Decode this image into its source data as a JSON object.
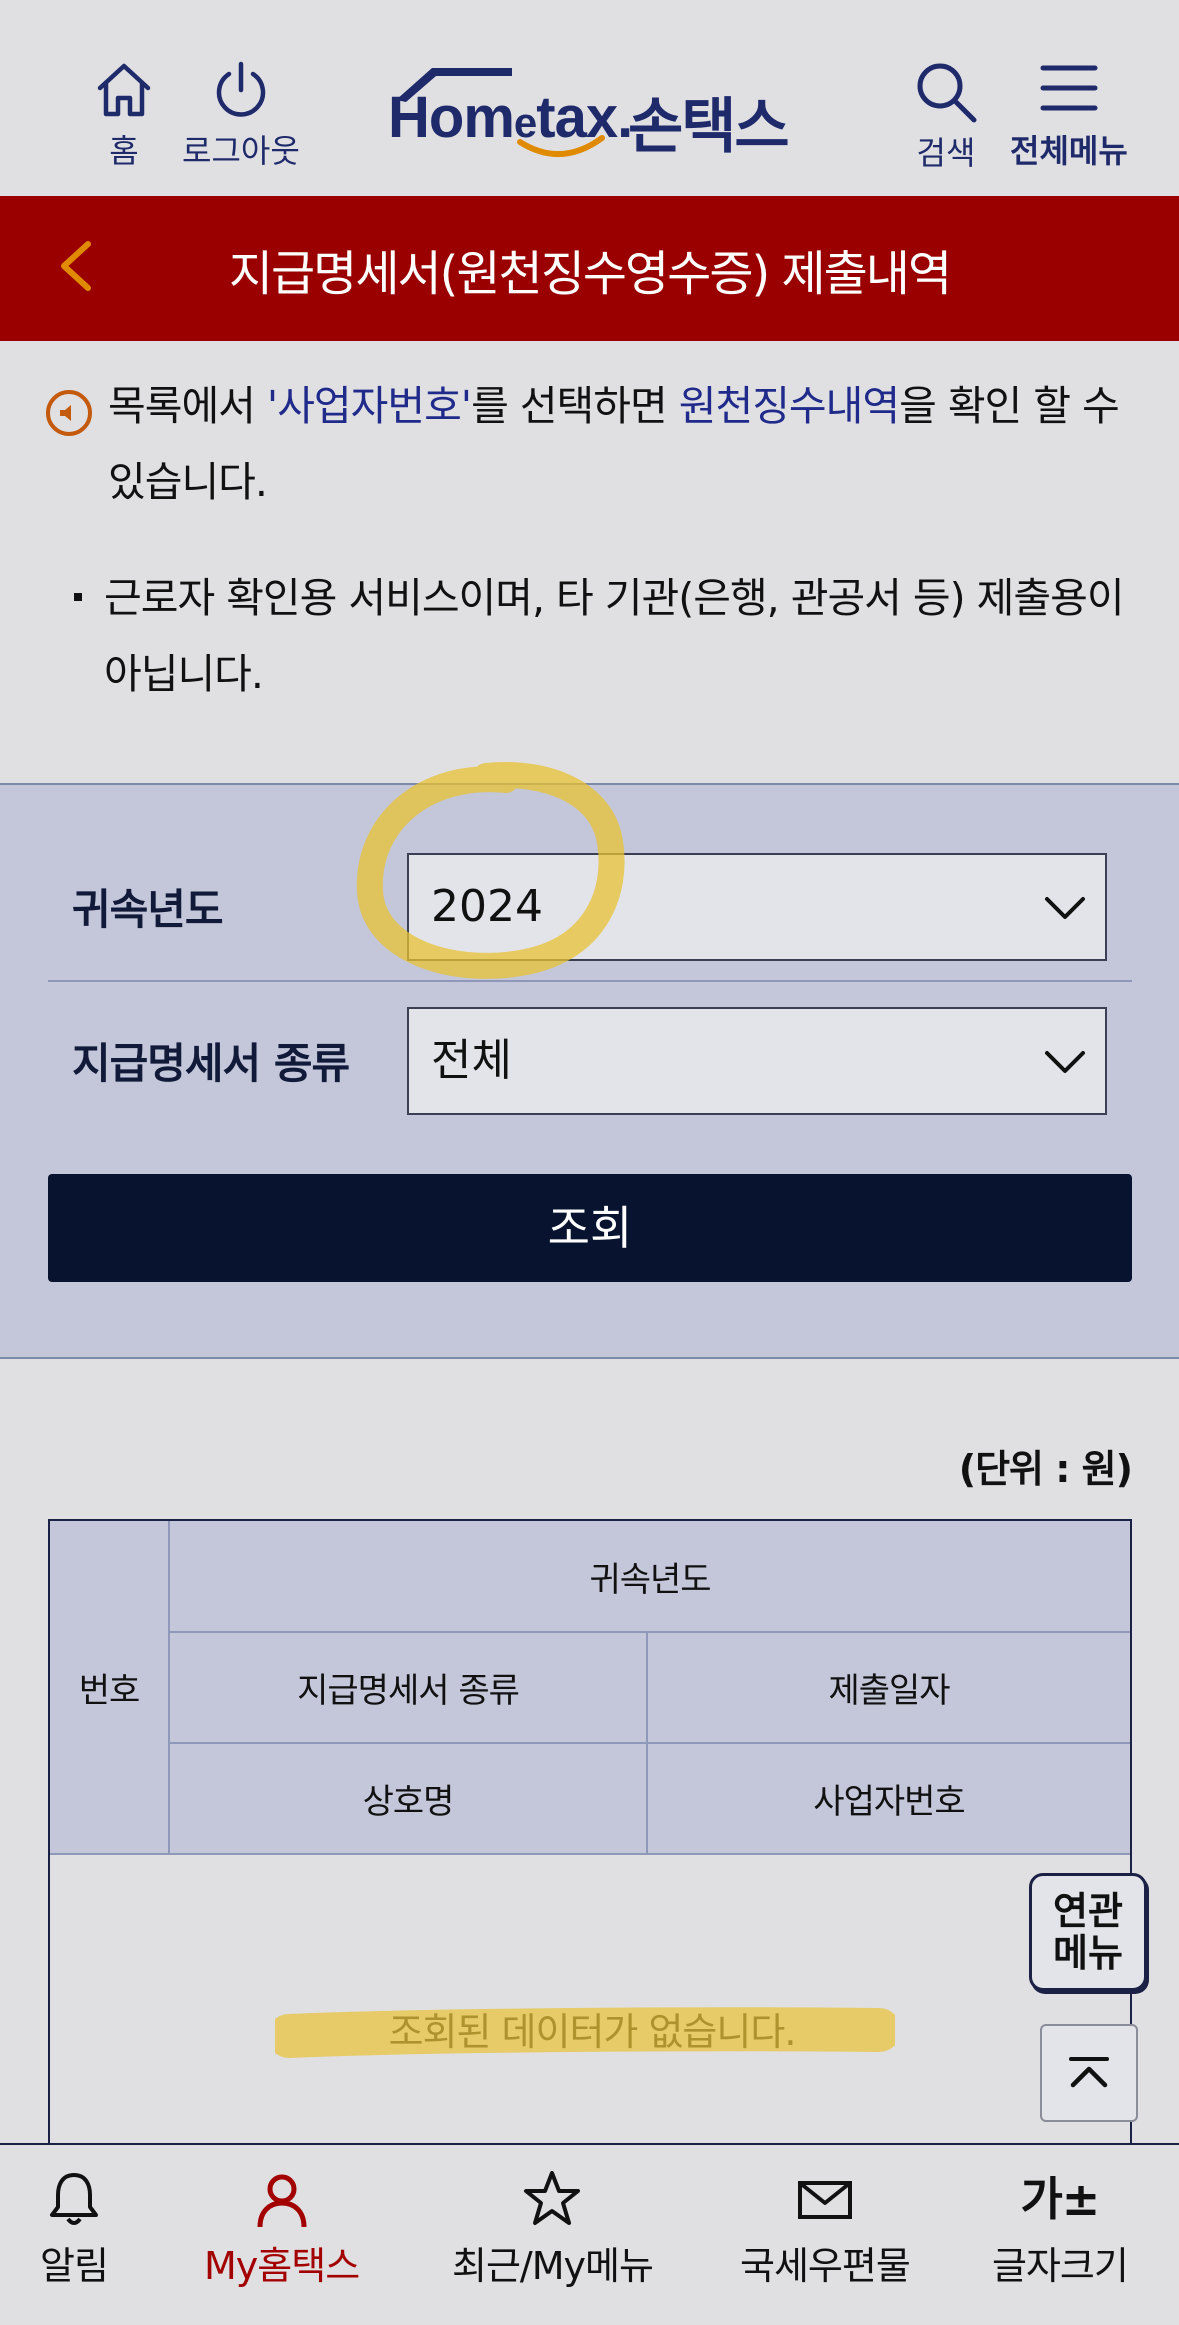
{
  "header": {
    "home_label": "홈",
    "logout_label": "로그아웃",
    "logo_prefix": "Hom",
    "logo_e": "e",
    "logo_suffix": "tax.",
    "logo_korean": "손택스",
    "search_label": "검색",
    "menu_label": "전체메뉴"
  },
  "titlebar": {
    "title": "지급명세서(원천징수영수증) 제출내역"
  },
  "notice": {
    "part1": "목록에서 ",
    "highlight1": "'사업자번호'",
    "part2": "를 선택하면 ",
    "highlight2": "원천징수내역",
    "part3": "을 확인 할 수 있습니다.",
    "bullet": "근로자 확인용 서비스이며, 타 기관(은행, 관공서 등) 제출용이 아닙니다."
  },
  "filters": {
    "year_label": "귀속년도",
    "year_value": "2024",
    "type_label": "지급명세서 종류",
    "type_value": "전체",
    "search_button": "조회"
  },
  "table": {
    "unit": "(단위 : 원)",
    "headers": {
      "number": "번호",
      "year": "귀속년도",
      "type": "지급명세서 종류",
      "submit_date": "제출일자",
      "company": "상호명",
      "biz_number": "사업자번호"
    },
    "empty_message": "조회된 데이터가 없습니다."
  },
  "floating": {
    "related_menu": "연관\n메뉴"
  },
  "bottom_nav": {
    "items": [
      {
        "label": "알림",
        "icon": "bell-icon"
      },
      {
        "label": "My홈택스",
        "icon": "person-icon"
      },
      {
        "label": "최근/My메뉴",
        "icon": "star-icon"
      },
      {
        "label": "국세우편물",
        "icon": "mail-icon"
      },
      {
        "label": "글자크기",
        "icon": "font-size-icon"
      }
    ],
    "font_icon_text": "가±"
  },
  "colors": {
    "brand_navy": "#1f2a6b",
    "title_red": "#9a0000",
    "active_red": "#a30000",
    "button_dark": "#081330",
    "highlight_yellow": "#e8c233"
  }
}
